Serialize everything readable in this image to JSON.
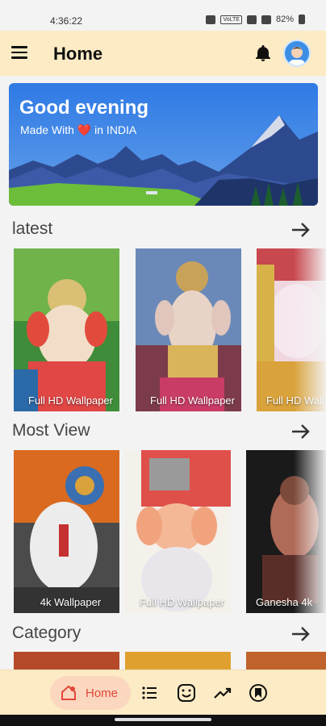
{
  "status_bar": {
    "time": "4:36:22",
    "net_label": "VoLTE",
    "battery": "82%"
  },
  "app_bar": {
    "title": "Home",
    "menu_icon": "menu-icon",
    "bell_icon": "bell-icon",
    "avatar_icon": "avatar"
  },
  "banner": {
    "greeting": "Good evening",
    "made_with_prefix": "Made With",
    "heart": "❤️",
    "made_with_suffix": "in INDIA"
  },
  "sections": {
    "latest": {
      "title": "latest",
      "cards": [
        "Full HD Wallpaper",
        "Full HD Wallpaper",
        "Full HD Wallpaper"
      ]
    },
    "most_view": {
      "title": "Most View",
      "cards": [
        "4k Wallpaper",
        "Full HD Wallpaper",
        "Ganesha 4k"
      ]
    },
    "category": {
      "title": "Category"
    }
  },
  "bottom_nav": {
    "home_label": "Home",
    "items": [
      "home-icon",
      "list-icon",
      "sticker-icon",
      "trending-icon",
      "bookmark-icon"
    ]
  },
  "colors": {
    "app_bar_bg": "#fcebc4",
    "accent": "#e2463a",
    "banner_blue": "#2f7ae5"
  }
}
